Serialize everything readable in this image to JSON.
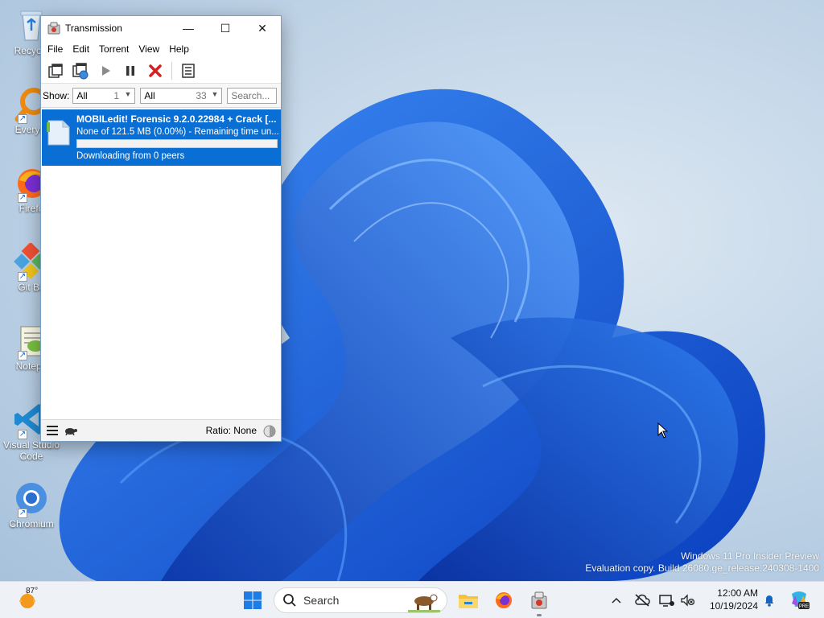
{
  "desktop": {
    "icons": [
      {
        "label": "Recycle"
      },
      {
        "label": "Everyth"
      },
      {
        "label": "Firefo"
      },
      {
        "label": "Git Ba"
      },
      {
        "label": "Notepa"
      },
      {
        "label": "Visual Studio Code"
      },
      {
        "label": "Chromium"
      }
    ],
    "watermark": {
      "line1": "Windows 11 Pro Insider Preview",
      "line2": "Evaluation copy. Build 26080.ge_release.240308-1400"
    }
  },
  "window": {
    "title": "Transmission",
    "icon": "transmission-icon",
    "controls": {
      "minimize": "—",
      "maximize": "☐",
      "close": "✕"
    },
    "menu": [
      "File",
      "Edit",
      "Torrent",
      "View",
      "Help"
    ],
    "toolbar": [
      "open-torrent-icon",
      "open-url-icon",
      "start-icon",
      "pause-icon",
      "remove-icon",
      "properties-icon"
    ],
    "filter": {
      "show_label": "Show:",
      "activity": {
        "value": "All",
        "count": "1"
      },
      "tracker": {
        "value": "All",
        "count": "33"
      },
      "search_placeholder": "Search..."
    },
    "torrents": [
      {
        "name": "MOBILedit! Forensic 9.2.0.22984 + Crack [...",
        "progress_text": "None of 121.5 MB (0.00%) - Remaining time un...",
        "progress": 0.0,
        "status": "Downloading from 0 peers"
      }
    ],
    "statusbar": {
      "ratio": "Ratio: None"
    }
  },
  "taskbar": {
    "weather_temp": "87°",
    "search_label": "Search",
    "apps": [
      "start-icon",
      "search",
      "file-explorer-icon",
      "firefox-icon",
      "transmission-icon"
    ],
    "tray": {
      "time": "12:00 AM",
      "date": "10/19/2024"
    }
  },
  "colors": {
    "accent": "#0a6fd4",
    "remove_red": "#d42020",
    "wallpaper_blue": "#1a5ce0"
  }
}
